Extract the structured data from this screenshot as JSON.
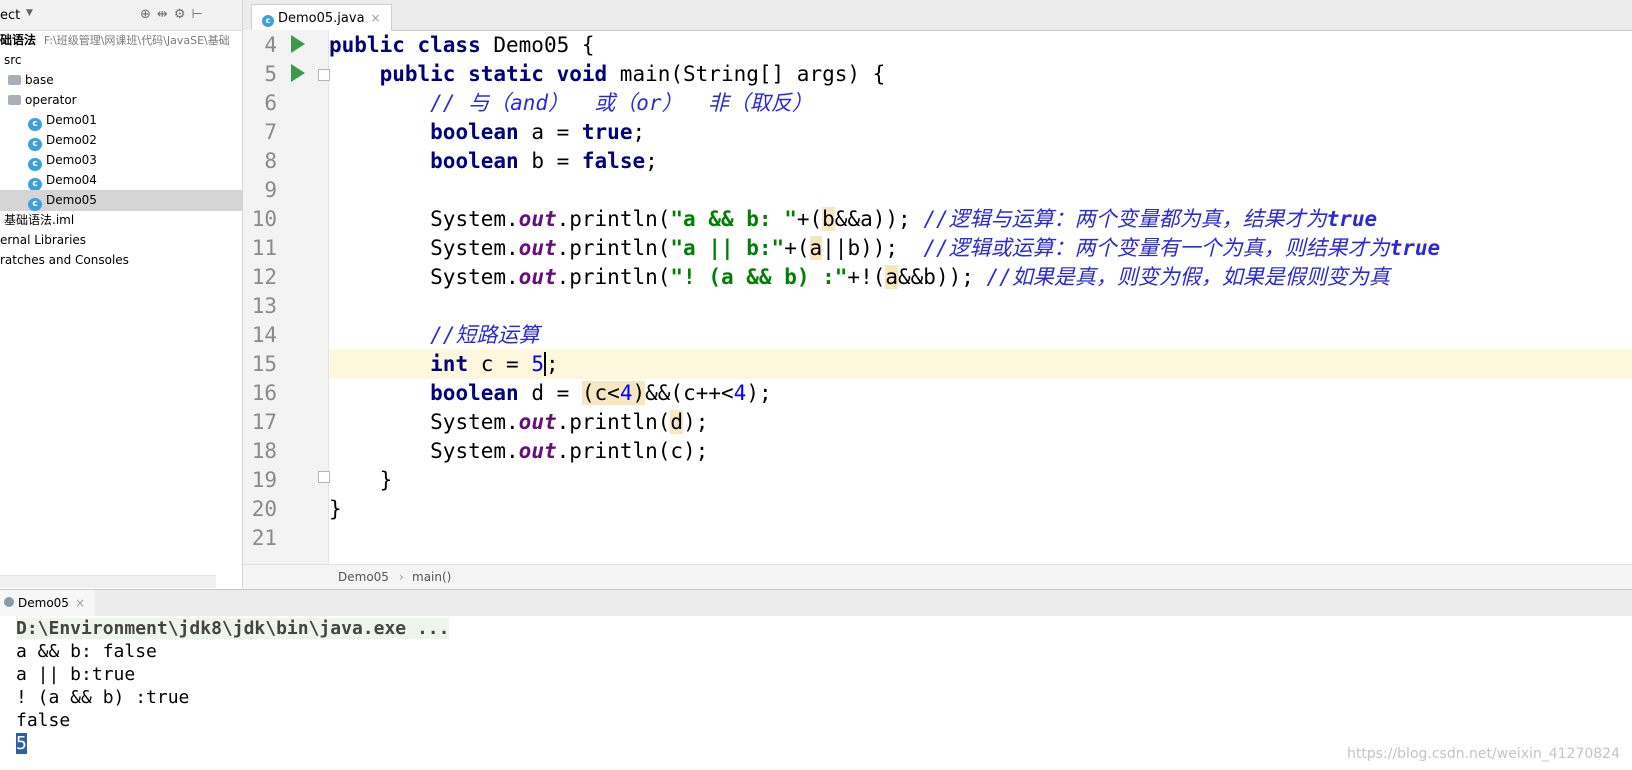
{
  "project": {
    "header_title": "ect",
    "root_label": "础语法",
    "root_path": "F:\\班级管理\\网课班\\代码\\JavaSE\\基础",
    "src": "src",
    "base": "base",
    "operator": "operator",
    "classes": [
      "Demo01",
      "Demo02",
      "Demo03",
      "Demo04",
      "Demo05"
    ],
    "iml": "基础语法.iml",
    "external": "ernal Libraries",
    "scratches": "ratches and Consoles"
  },
  "editor": {
    "tab_label": "Demo05.java",
    "line_numbers": [
      "4",
      "5",
      "6",
      "7",
      "8",
      "9",
      "10",
      "11",
      "12",
      "13",
      "14",
      "15",
      "16",
      "17",
      "18",
      "19",
      "20",
      "21"
    ],
    "lines": {
      "l4": [
        "public class ",
        "Demo05 {"
      ],
      "l5": [
        "public static void ",
        "main(String[] args) {"
      ],
      "l6": "// 与（and）  或（or）  非（取反）",
      "l7": [
        "boolean ",
        "a = ",
        "true",
        ";"
      ],
      "l8": [
        "boolean ",
        "b = ",
        "false",
        ";"
      ],
      "l10": [
        "System.",
        "out",
        ".println(",
        "\"a && b: \"",
        "+(",
        "b",
        "&&a)); ",
        "//逻辑与运算：两个变量都为真，结果才为",
        "true"
      ],
      "l11": [
        "System.",
        "out",
        ".println(",
        "\"a || b:\"",
        "+(",
        "a",
        "||b));  ",
        "//逻辑或运算：两个变量有一个为真，则结果才为",
        "true"
      ],
      "l12": [
        "System.",
        "out",
        ".println(",
        "\"! (a && b) :\"",
        "+!(",
        "a",
        "&&b)); ",
        "//如果是真，则变为假，如果是假则变为真"
      ],
      "l14": "//短路运算",
      "l15": [
        "int ",
        "c = ",
        "5",
        ";"
      ],
      "l16": [
        "boolean ",
        "d = ",
        "(c<",
        "4",
        ")",
        "&&(c++<",
        "4",
        ");"
      ],
      "l17": [
        "System.",
        "out",
        ".println(",
        "d",
        ");"
      ],
      "l18": [
        "System.",
        "out",
        ".println(c);"
      ],
      "l19": "}",
      "l20": "}"
    },
    "breadcrumb": [
      "Demo05",
      "main()"
    ],
    "breadcrumb_sep": "›"
  },
  "run": {
    "tab_label": "Demo05",
    "output": [
      "D:\\Environment\\jdk8\\jdk\\bin\\java.exe ...",
      "a && b: false",
      "a || b:true",
      "! (a && b) :true",
      "false",
      "5"
    ]
  },
  "watermark": "https://blog.csdn.net/weixin_41270824",
  "colors": {
    "keyword": "#000080",
    "string": "#008000",
    "field": "#660e7a",
    "comment": "#2b2bd6",
    "number": "#0000ff",
    "current_line": "#fdf7de"
  }
}
